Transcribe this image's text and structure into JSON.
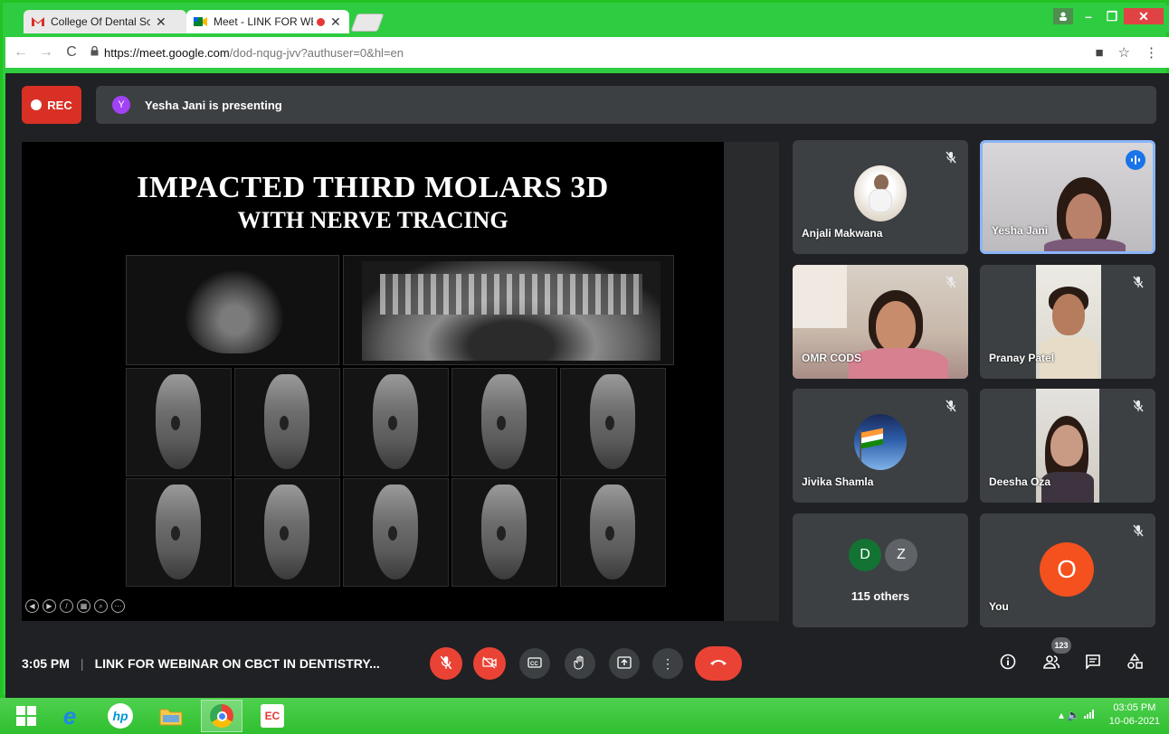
{
  "browser": {
    "tabs": [
      {
        "favicon": "gmail-icon",
        "title": "College Of Dental Scienc",
        "close": "✕"
      },
      {
        "favicon": "meet-icon",
        "title": "Meet - LINK FOR WE",
        "close": "✕"
      }
    ],
    "url_host": "https://meet.google.com",
    "url_path": "/dod-nqug-jvv?authuser=0&hl=en"
  },
  "meet": {
    "rec_label": "REC",
    "presenter_initial": "Y",
    "presenting_text": "Yesha Jani is presenting",
    "slide": {
      "title_line1": "IMPACTED THIRD MOLARS 3D",
      "title_line2": "WITH NERVE TRACING"
    },
    "participants": [
      {
        "name": "Anjali Makwana",
        "muted": true
      },
      {
        "name": "Yesha Jani",
        "speaking": true
      },
      {
        "name": "OMR CODS",
        "muted": true
      },
      {
        "name": "Pranay Patel",
        "muted": true
      },
      {
        "name": "Jivika Shamla",
        "muted": true
      },
      {
        "name": "Deesha Oza",
        "muted": true
      }
    ],
    "others": {
      "avatars": [
        "D",
        "Z"
      ],
      "label": "115 others"
    },
    "you": {
      "initial": "O",
      "label": "You"
    },
    "bottom": {
      "time": "3:05 PM",
      "separator": "|",
      "meeting_title": "LINK FOR WEBINAR ON CBCT IN DENTISTRY...",
      "people_count": "123"
    }
  },
  "taskbar": {
    "clock_time": "03:05 PM",
    "clock_date": "10-06-2021"
  },
  "colors": {
    "accent_green": "#2ecc40",
    "meet_bg": "#202124",
    "tile_bg": "#3c4043",
    "danger_red": "#ea4335",
    "you_orange": "#f4511e",
    "speaking_blue": "#1a73e8"
  }
}
